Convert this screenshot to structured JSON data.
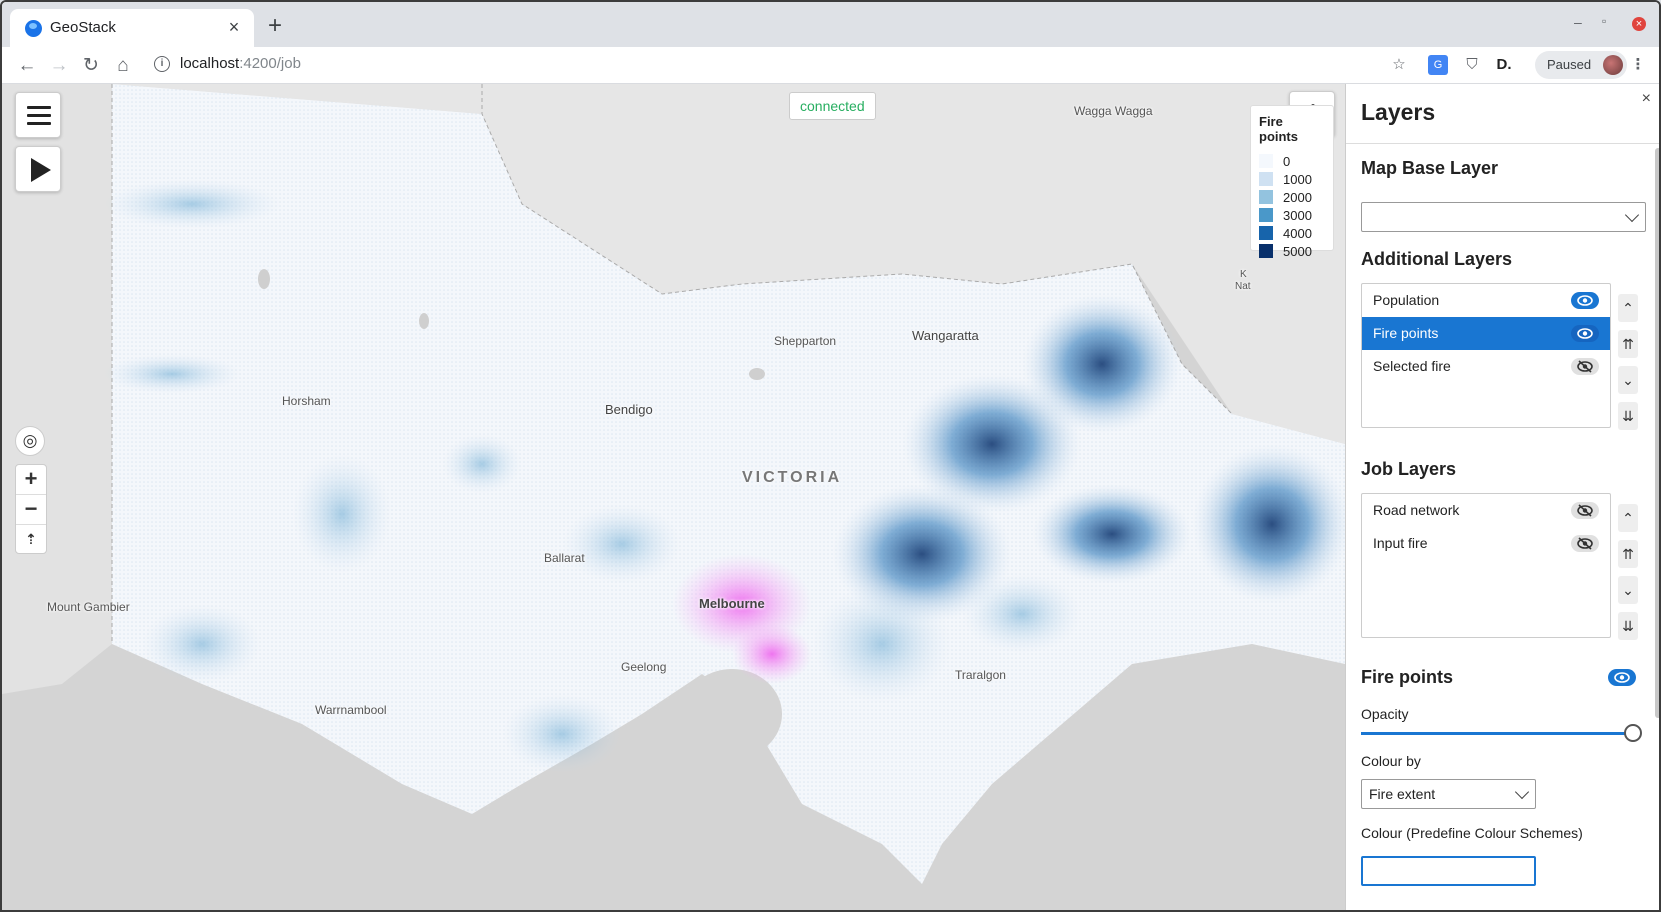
{
  "browser": {
    "tab_title": "GeoStack",
    "tab_close": "×",
    "new_tab": "+",
    "url_host": "localhost",
    "url_path": ":4200/job",
    "profile_status": "Paused",
    "window_controls": [
      "–",
      "▫",
      "×"
    ]
  },
  "map": {
    "status": "connected",
    "labels": {
      "wagga": "Wagga Wagga",
      "shepparton": "Shepparton",
      "wangaratta": "Wangaratta",
      "horsham": "Horsham",
      "bendigo": "Bendigo",
      "victoria": "VICTORIA",
      "ballarat": "Ballarat",
      "melbourne": "Melbourne",
      "mount_gambier": "Mount Gambier",
      "geelong": "Geelong",
      "traralgon": "Traralgon",
      "warrnambool": "Warrnambool",
      "kiewa": "K",
      "nat": "Nat"
    },
    "zoom_in": "+",
    "zoom_out": "−",
    "compass": "⇡"
  },
  "legend": {
    "title": "Fire points",
    "entries": [
      {
        "label": "0",
        "color": "#f4f8fd"
      },
      {
        "label": "1000",
        "color": "#cfe1f2"
      },
      {
        "label": "2000",
        "color": "#93c3df"
      },
      {
        "label": "3000",
        "color": "#4a98c9"
      },
      {
        "label": "4000",
        "color": "#1764ab"
      },
      {
        "label": "5000",
        "color": "#08306b"
      }
    ]
  },
  "panel": {
    "title": "Layers",
    "close": "×",
    "map_base_layer": "Map Base Layer",
    "additional_layers_title": "Additional Layers",
    "additional_layers": [
      {
        "label": "Population",
        "visible": true,
        "active": false
      },
      {
        "label": "Fire points",
        "visible": true,
        "active": true
      },
      {
        "label": "Selected fire",
        "visible": false,
        "active": false
      }
    ],
    "job_layers_title": "Job Layers",
    "job_layers": [
      {
        "label": "Road network",
        "visible": false
      },
      {
        "label": "Input fire",
        "visible": false
      }
    ],
    "order_buttons": [
      "⌃",
      "⇈",
      "⌄",
      "⇊"
    ],
    "detail_title": "Fire points",
    "opacity_label": "Opacity",
    "opacity_value": 1.0,
    "colour_by_label": "Colour by",
    "colour_by_value": "Fire extent",
    "colour_scheme_label": "Colour (Predefine Colour Schemes)"
  },
  "colors": {
    "accent": "#1976d2",
    "connected": "#27ae60"
  }
}
